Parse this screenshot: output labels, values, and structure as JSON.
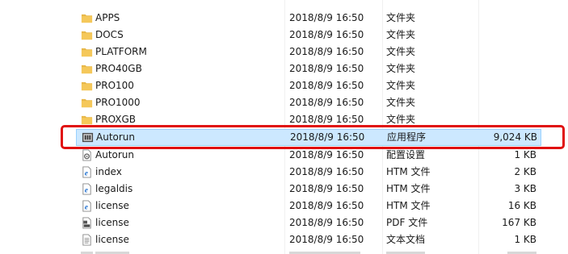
{
  "files": [
    {
      "name": "APPS",
      "date": "2018/8/9 16:50",
      "type": "文件夹",
      "size": "",
      "icon": "folder-icon"
    },
    {
      "name": "DOCS",
      "date": "2018/8/9 16:50",
      "type": "文件夹",
      "size": "",
      "icon": "folder-icon"
    },
    {
      "name": "PLATFORM",
      "date": "2018/8/9 16:50",
      "type": "文件夹",
      "size": "",
      "icon": "folder-icon"
    },
    {
      "name": "PRO40GB",
      "date": "2018/8/9 16:50",
      "type": "文件夹",
      "size": "",
      "icon": "folder-icon"
    },
    {
      "name": "PRO100",
      "date": "2018/8/9 16:50",
      "type": "文件夹",
      "size": "",
      "icon": "folder-icon"
    },
    {
      "name": "PRO1000",
      "date": "2018/8/9 16:50",
      "type": "文件夹",
      "size": "",
      "icon": "folder-icon"
    },
    {
      "name": "PROXGB",
      "date": "2018/8/9 16:50",
      "type": "文件夹",
      "size": "",
      "icon": "folder-icon"
    },
    {
      "name": "Autorun",
      "date": "2018/8/9 16:50",
      "type": "应用程序",
      "size": "9,024 KB",
      "icon": "application-icon",
      "selected": true
    },
    {
      "name": "Autorun",
      "date": "2018/8/9 16:50",
      "type": "配置设置",
      "size": "1 KB",
      "icon": "config-settings-icon"
    },
    {
      "name": "index",
      "date": "2018/8/9 16:50",
      "type": "HTM 文件",
      "size": "2 KB",
      "icon": "htm-file-icon"
    },
    {
      "name": "legaldis",
      "date": "2018/8/9 16:50",
      "type": "HTM 文件",
      "size": "3 KB",
      "icon": "htm-file-icon"
    },
    {
      "name": "license",
      "date": "2018/8/9 16:50",
      "type": "HTM 文件",
      "size": "16 KB",
      "icon": "htm-file-icon"
    },
    {
      "name": "license",
      "date": "2018/8/9 16:50",
      "type": "PDF 文件",
      "size": "167 KB",
      "icon": "pdf-file-icon"
    },
    {
      "name": "license",
      "date": "2018/8/9 16:50",
      "type": "文本文档",
      "size": "1 KB",
      "icon": "text-document-icon"
    }
  ],
  "colors": {
    "selection_fill": "#cce8ff",
    "selection_border": "#99d1ff",
    "highlight_box": "#e01010",
    "folder": "#f5c85a"
  }
}
